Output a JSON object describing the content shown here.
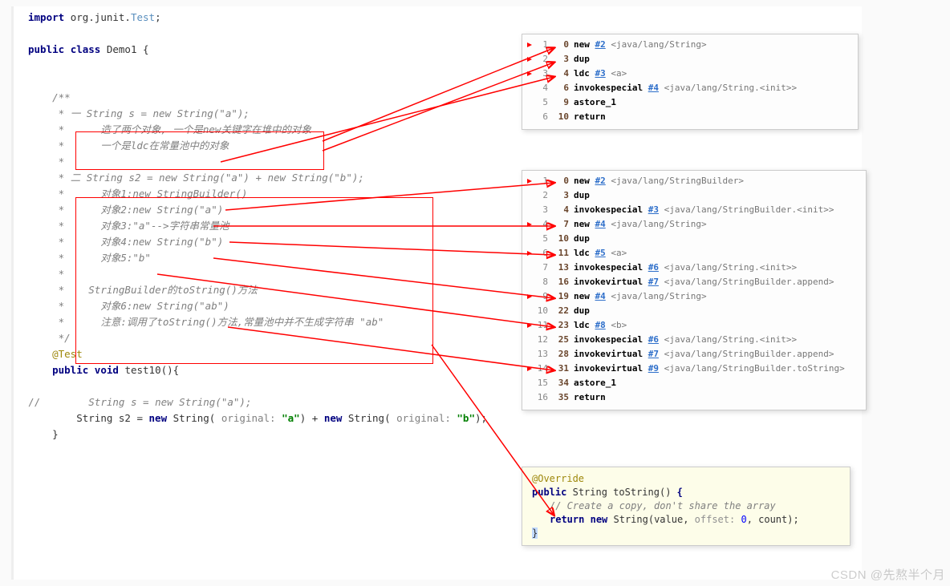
{
  "source": {
    "l1_import": "import",
    "l1_pkg": "org.junit.",
    "l1_test": "Test",
    "l1_semi": ";",
    "l2_public": "public",
    "l2_class": "class",
    "l2_name": "Demo1 {",
    "c_open": "/**",
    "c_star": "*",
    "c_one": "* 一",
    "c_one_txt": "String s = new String(\"a\");",
    "c_one_a": "造了两个对象, 一个是new关键字在堆中的对象",
    "c_one_b": "一个是ldc在常量池中的对象",
    "c_two": "* 二",
    "c_two_txt": "String s2 = new String(\"a\") + new String(\"b\");",
    "c_obj1": "对象1:new StringBuilder()",
    "c_obj2": "对象2:new String(\"a\")",
    "c_obj3": "对象3:\"a\"-->字符串常量池",
    "c_obj4": "对象4:new String(\"b\")",
    "c_obj5": "对象5:\"b\"",
    "c_sb": "StringBuilder的toString()方法",
    "c_obj6": "对象6:new String(\"ab\")",
    "c_note": "注意:调用了toString()方法,常量池中并不生成字符串 \"ab\"",
    "c_close": "*/",
    "ann_test": "@Test",
    "m_public": "public",
    "m_void": "void",
    "m_name": "test10(){",
    "slash": "//",
    "m_comment": "String s = new String(\"a\");",
    "m_s2_a": "String s2 = ",
    "m_new": "new",
    "m_string": " String(",
    "m_hint1": " original: ",
    "m_lit_a": "\"a\"",
    "m_plus": " + ",
    "m_lit_b": "\"b\"",
    "m_paren_semi": ");",
    "m_close": "}"
  },
  "bytecode1": {
    "rows": [
      {
        "ln": "1",
        "off": "0",
        "op": "new",
        "ref": "#2",
        "cmt": "<java/lang/String>"
      },
      {
        "ln": "2",
        "off": "3",
        "op": "dup"
      },
      {
        "ln": "3",
        "off": "4",
        "op": "ldc",
        "ref": "#3",
        "cmt": "<a>"
      },
      {
        "ln": "4",
        "off": "6",
        "op": "invokespecial",
        "ref": "#4",
        "cmt": "<java/lang/String.<init>>"
      },
      {
        "ln": "5",
        "off": "9",
        "op": "astore_1"
      },
      {
        "ln": "6",
        "off": "10",
        "op": "return"
      }
    ]
  },
  "bytecode2": {
    "rows": [
      {
        "ln": "1",
        "off": "0",
        "op": "new",
        "ref": "#2",
        "cmt": "<java/lang/StringBuilder>"
      },
      {
        "ln": "2",
        "off": "3",
        "op": "dup"
      },
      {
        "ln": "3",
        "off": "4",
        "op": "invokespecial",
        "ref": "#3",
        "cmt": "<java/lang/StringBuilder.<init>>"
      },
      {
        "ln": "4",
        "off": "7",
        "op": "new",
        "ref": "#4",
        "cmt": "<java/lang/String>"
      },
      {
        "ln": "5",
        "off": "10",
        "op": "dup"
      },
      {
        "ln": "6",
        "off": "11",
        "op": "ldc",
        "ref": "#5",
        "cmt": "<a>"
      },
      {
        "ln": "7",
        "off": "13",
        "op": "invokespecial",
        "ref": "#6",
        "cmt": "<java/lang/String.<init>>"
      },
      {
        "ln": "8",
        "off": "16",
        "op": "invokevirtual",
        "ref": "#7",
        "cmt": "<java/lang/StringBuilder.append>"
      },
      {
        "ln": "9",
        "off": "19",
        "op": "new",
        "ref": "#4",
        "cmt": "<java/lang/String>"
      },
      {
        "ln": "10",
        "off": "22",
        "op": "dup"
      },
      {
        "ln": "11",
        "off": "23",
        "op": "ldc",
        "ref": "#8",
        "cmt": "<b>"
      },
      {
        "ln": "12",
        "off": "25",
        "op": "invokespecial",
        "ref": "#6",
        "cmt": "<java/lang/String.<init>>"
      },
      {
        "ln": "13",
        "off": "28",
        "op": "invokevirtual",
        "ref": "#7",
        "cmt": "<java/lang/StringBuilder.append>"
      },
      {
        "ln": "14",
        "off": "31",
        "op": "invokevirtual",
        "ref": "#9",
        "cmt": "<java/lang/StringBuilder.toString>"
      },
      {
        "ln": "15",
        "off": "34",
        "op": "astore_1"
      },
      {
        "ln": "16",
        "off": "35",
        "op": "return"
      }
    ]
  },
  "snippet": {
    "override": "@Override",
    "public": "public",
    "string": " String toString() ",
    "brace": "{",
    "comment": "// Create a copy, don't share the array",
    "return": "return",
    "new": "new",
    "body": " String(value, ",
    "hint": " offset: ",
    "zero": "0",
    "tail": ", count);",
    "cbrace": "}"
  },
  "watermark": "CSDN @先熬半个月"
}
